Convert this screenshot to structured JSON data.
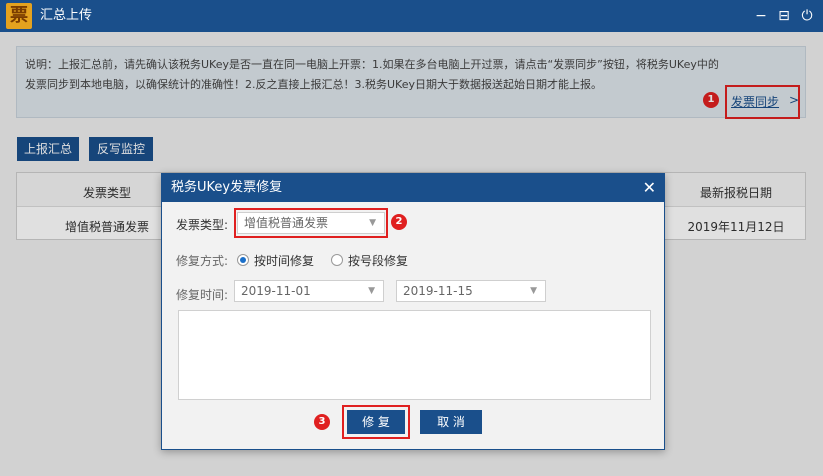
{
  "window": {
    "logo_glyph": "票",
    "title": "汇总上传",
    "controls": {
      "minimize": "−",
      "restore": "⊟",
      "close": "⏻"
    }
  },
  "notice": {
    "text": "说明：上报汇总前，请先确认该税务UKey是否一直在同一电脑上开票：1.如果在多台电脑上开过票，请点击“发票同步”按钮，将税务UKey中的发票同步到本地电脑，以确保统计的准确性！2.反之直接上报汇总！3.税务UKey日期大于数据报送起始日期才能上报。",
    "sync_link": "发票同步",
    "sync_chevron": ">"
  },
  "annotations": {
    "badge_1": "1",
    "badge_2": "2",
    "badge_3": "3"
  },
  "toolbar": {
    "upload_summary": "上报汇总",
    "writeback_monitor": "反写监控"
  },
  "table": {
    "headers": {
      "invoice_type": "发票类型",
      "last_tax_date": "最新报税日期"
    },
    "rows": [
      {
        "invoice_type": "增值税普通发票",
        "last_tax_date": "2019年11月12日"
      }
    ]
  },
  "dialog": {
    "title": "税务UKey发票修复",
    "close": "✕",
    "invoice_type_label": "发票类型:",
    "invoice_type_value": "增值税普通发票",
    "repair_mode_label": "修复方式:",
    "mode_by_time": "按时间修复",
    "mode_by_segment": "按号段修复",
    "repair_time_label": "修复时间:",
    "date_start": "2019-11-01",
    "date_end": "2019-11-15",
    "repair_button": "修 复",
    "cancel_button": "取 消"
  },
  "colors": {
    "primary": "#1a4f8b",
    "highlight": "#e02020",
    "logo": "#e4a21f"
  }
}
